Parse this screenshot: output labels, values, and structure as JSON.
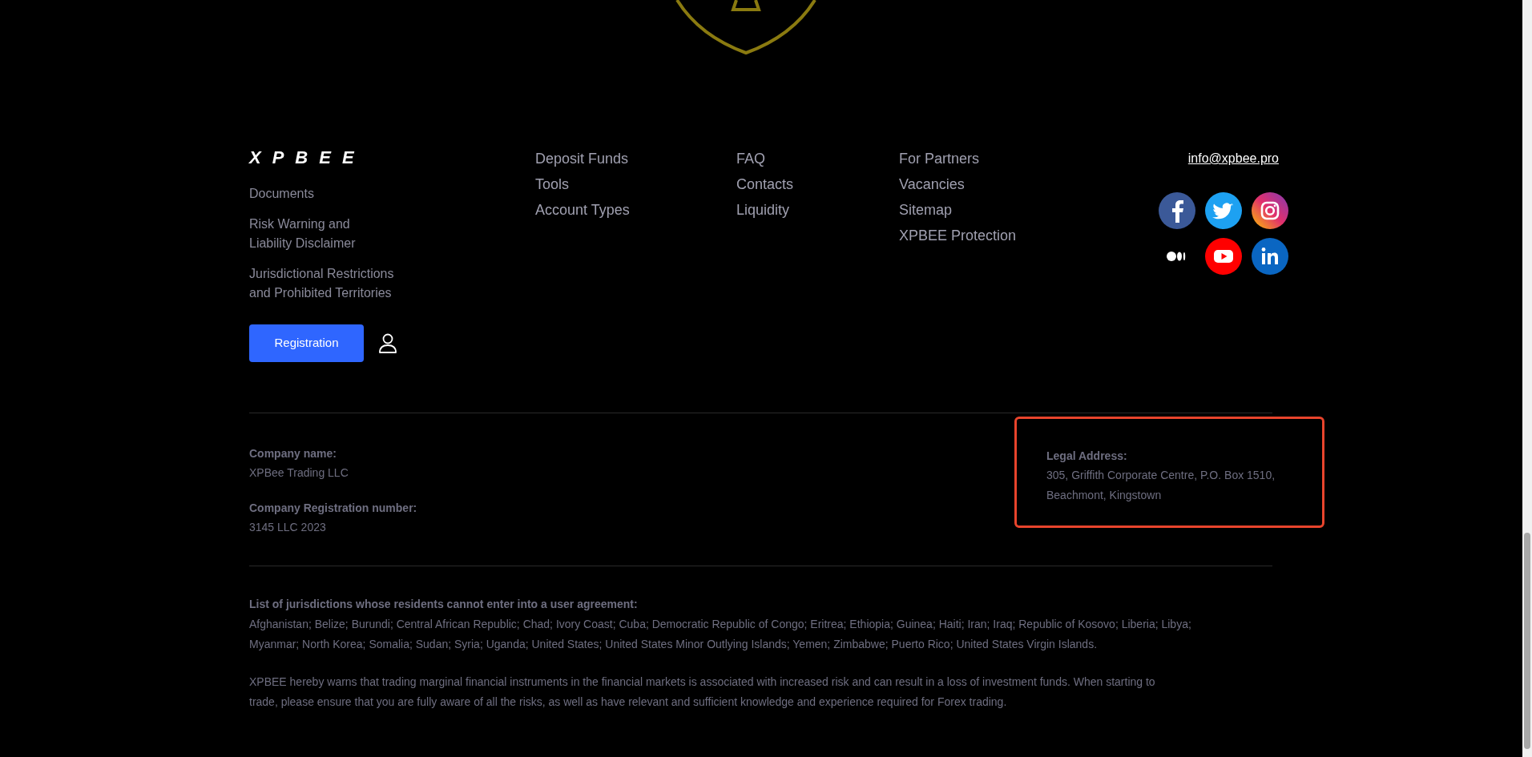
{
  "brand": {
    "logo": "XPBEE"
  },
  "documents": [
    {
      "label": "Documents"
    },
    {
      "label": "Risk Warning and\nLiability Disclaimer"
    },
    {
      "label": "Jurisdictional Restrictions\nand Prohibited Territories"
    }
  ],
  "registration_button": "Registration",
  "link_columns": [
    [
      "Deposit Funds",
      "Tools",
      "Account Types"
    ],
    [
      "FAQ",
      "Contacts",
      "Liquidity"
    ],
    [
      "For Partners",
      "Vacancies",
      "Sitemap",
      "XPBEE Protection"
    ]
  ],
  "email": "info@xpbee.pro",
  "social": [
    {
      "kind": "facebook",
      "color": "#3b5998"
    },
    {
      "kind": "twitter",
      "color": "#1da1f2"
    },
    {
      "kind": "instagram"
    },
    {
      "kind": "medium",
      "color": "#000000"
    },
    {
      "kind": "youtube",
      "color": "#ff0000"
    },
    {
      "kind": "linkedin",
      "color": "#0a66c2"
    }
  ],
  "company": [
    {
      "label": "Company name:",
      "value": "XPBee Trading LLC"
    },
    {
      "label": "Company Registration number:",
      "value": "3145 LLC 2023"
    }
  ],
  "legal_address": {
    "label": "Legal Address:",
    "value": "305, Griffith Corporate Centre, P.O. Box 1510,\nBeachmont, Kingstown",
    "highlighted": true
  },
  "jurisdictions": {
    "title": "List of jurisdictions whose residents cannot enter into a user agreement:",
    "text": "Afghanistan; Belize; Burundi; Central African Republic; Chad; Ivory Coast; Cuba; Democratic Republic of Congo; Eritrea; Ethiopia; Guinea; Haiti; Iran; Iraq; Republic of Kosovo; Liberia; Libya;\nMyanmar; North Korea; Somalia; Sudan; Syria; Uganda; United States; United States Minor Outlying Islands; Yemen; Zimbabwe; Puerto Rico; United States Virgin Islands."
  },
  "warning": "XPBEE hereby warns that trading marginal financial instruments in the financial markets is associated with increased risk and can result in a loss of investment funds. When starting to\ntrade, please ensure that you are fully aware of all the risks, as well as have relevant and sufficient knowledge and experience required for Forex trading."
}
